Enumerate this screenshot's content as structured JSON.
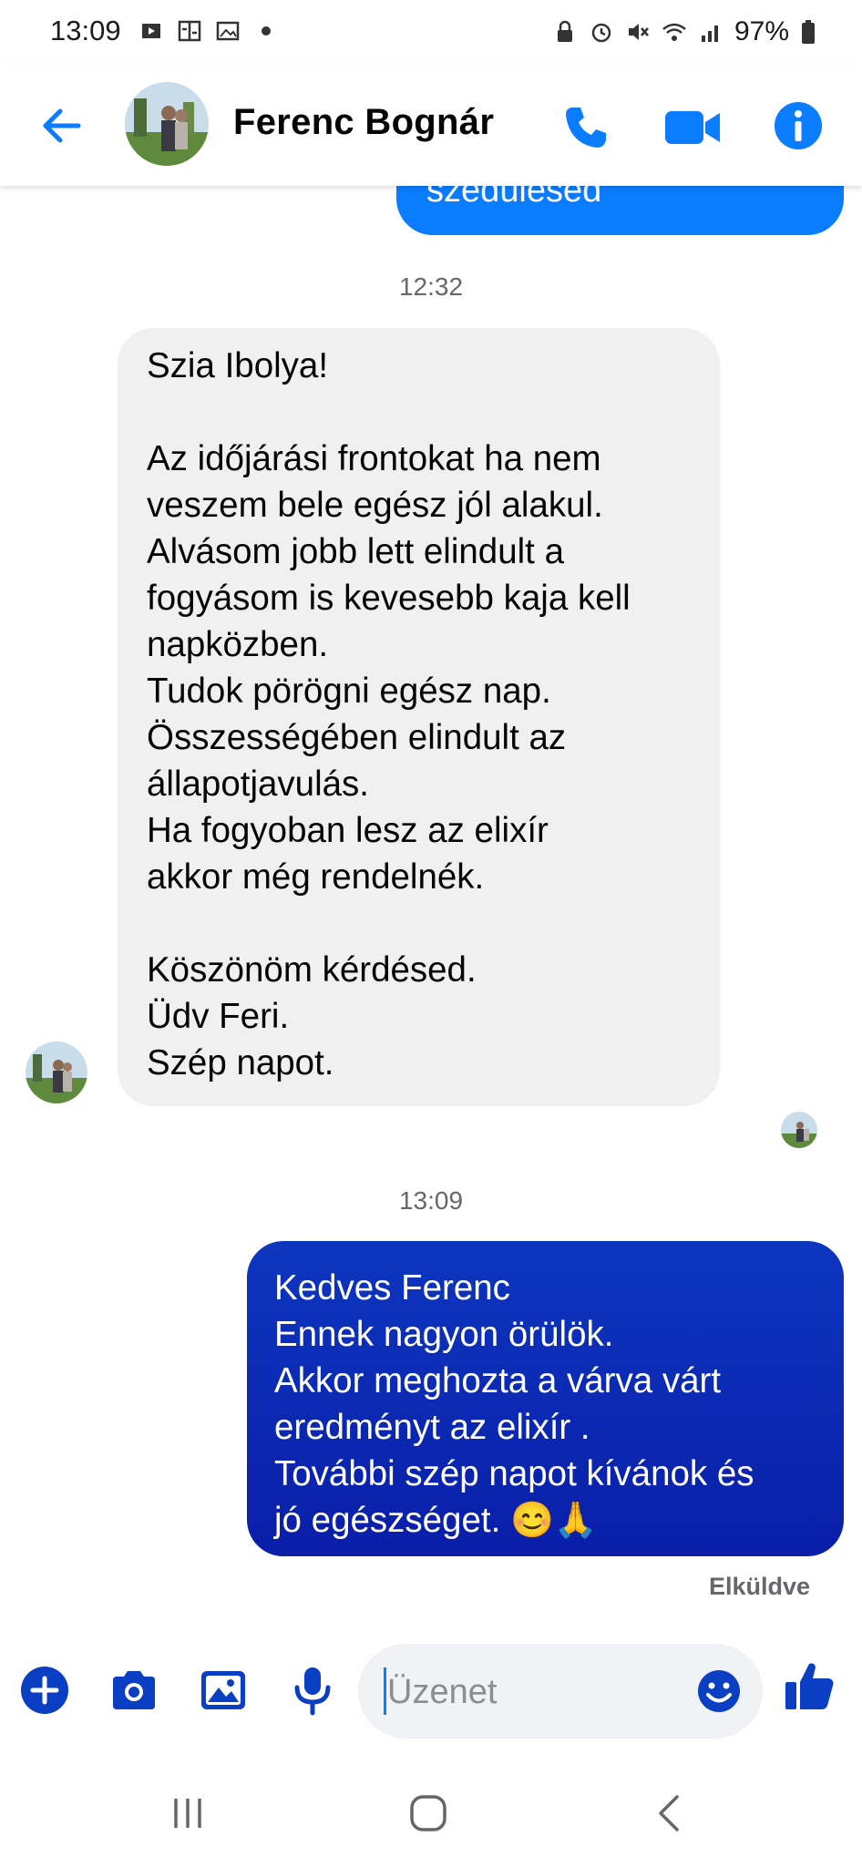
{
  "status_bar": {
    "time": "13:09",
    "battery": "97%",
    "left_icons": [
      "media-icon",
      "translate-icon",
      "gallery-icon",
      "dot-icon"
    ],
    "right_icons": [
      "lock-icon",
      "alarm-icon",
      "mute-icon",
      "wifi-icon",
      "signal-icon",
      "battery-icon"
    ]
  },
  "header": {
    "contact_name": "Ferenc Bognár",
    "icons": [
      "back-arrow-icon",
      "phone-icon",
      "video-camera-icon",
      "info-icon"
    ],
    "accent_color": "#0a7cff"
  },
  "messages": {
    "partial_outgoing": "szédülésed",
    "timestamp_1": "12:32",
    "incoming_text": "Szia Ibolya!\n\nAz időjárási frontokat ha nem\nveszem bele egész jól alakul.\nAlvásom jobb lett elindult a\nfogyásom is kevesebb kaja kell\nnapközben.\nTudok pörögni egész nap.\nÖsszességében elindult az\nállapotjavulás.\nHa fogyoban lesz az elixír\nakkor még rendelnék.\n\nKöszönöm kérdésed.\nÜdv Feri.\nSzép napot.",
    "timestamp_2": "13:09",
    "outgoing_text": "Kedves Ferenc\nEnnek nagyon örülök.\nAkkor meghozta a várva várt\neredményt az elixír .\nTovábbi szép napot kívánok és\njó egészséget. 😊🙏",
    "status": "Elküldve"
  },
  "composer": {
    "placeholder": "Üzenet",
    "value": "",
    "icons": [
      "add-icon",
      "camera-icon",
      "image-icon",
      "microphone-icon",
      "emoji-icon",
      "thumbs-up-icon"
    ]
  },
  "nav_bar": {
    "icons": [
      "recent-apps-icon",
      "home-icon",
      "back-icon"
    ]
  }
}
